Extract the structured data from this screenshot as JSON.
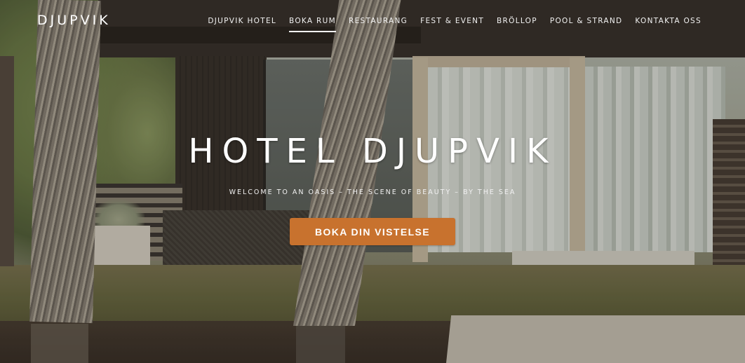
{
  "brand": {
    "logo_text": "DJUPVIK"
  },
  "nav": {
    "items": [
      {
        "label": "DJUPVIK HOTEL"
      },
      {
        "label": "BOKA RUM",
        "active": true
      },
      {
        "label": "RESTAURANG"
      },
      {
        "label": "FEST & EVENT"
      },
      {
        "label": "BRÖLLOP"
      },
      {
        "label": "POOL & STRAND"
      },
      {
        "label": "KONTAKTA OSS"
      }
    ]
  },
  "hero": {
    "title": "HOTEL DJUPVIK",
    "subtitle": "WELCOME TO AN OASIS – THE SCENE OF BEAUTY – BY THE SEA",
    "cta_label": "BOKA DIN VISTELSE"
  },
  "colors": {
    "accent": "#c8722e",
    "nav_text": "#ffffff"
  }
}
